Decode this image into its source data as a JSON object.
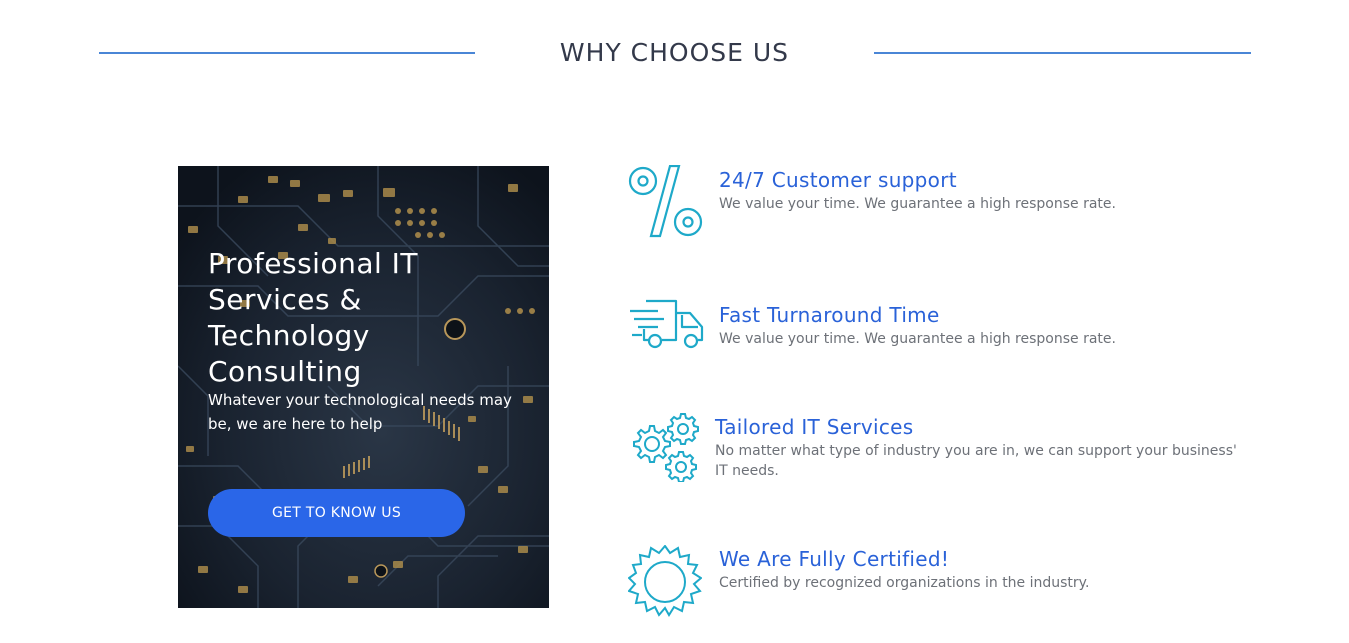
{
  "section": {
    "title": "WHY CHOOSE US"
  },
  "hero": {
    "title": "Professional IT Services & Technology Consulting",
    "subtitle": "Whatever your technological needs may be, we are here to help",
    "button_label": "GET TO KNOW US"
  },
  "features": [
    {
      "icon": "percent-icon",
      "title": "24/7 Customer support",
      "description": "We value your time. We guarantee a high response rate."
    },
    {
      "icon": "delivery-truck-icon",
      "title": "Fast Turnaround Time",
      "description": "We value your time. We guarantee a high response rate."
    },
    {
      "icon": "gears-icon",
      "title": "Tailored IT Services",
      "description": "No matter what type of industry you are in, we can support your business' IT needs."
    },
    {
      "icon": "certified-badge-icon",
      "title": "We Are Fully Certified!",
      "description": "Certified by recognized organizations in the industry."
    }
  ],
  "colors": {
    "heading_line": "#4a86d6",
    "feature_title": "#2a62d8",
    "icon_stroke": "#1ea9c9",
    "button": "#2a66e8"
  }
}
